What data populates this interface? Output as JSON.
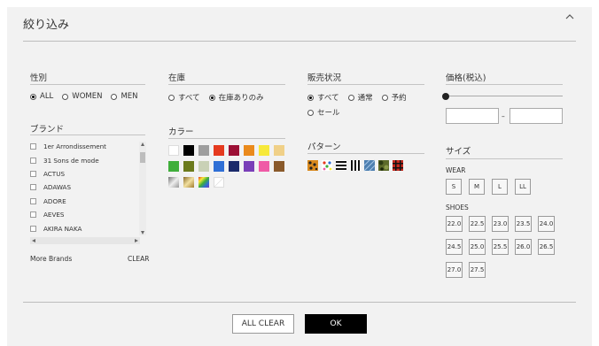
{
  "header": {
    "title": "絞り込み"
  },
  "gender": {
    "title": "性別",
    "options": [
      {
        "label": "ALL",
        "checked": true
      },
      {
        "label": "WOMEN",
        "checked": false
      },
      {
        "label": "MEN",
        "checked": false
      }
    ]
  },
  "stock": {
    "title": "在庫",
    "options": [
      {
        "label": "すべて",
        "checked": false
      },
      {
        "label": "在庫ありのみ",
        "checked": true
      }
    ]
  },
  "sales": {
    "title": "販売状況",
    "options": [
      {
        "label": "すべて",
        "checked": true
      },
      {
        "label": "通常",
        "checked": false
      },
      {
        "label": "予約",
        "checked": false
      },
      {
        "label": "セール",
        "checked": false
      }
    ]
  },
  "price": {
    "title": "価格(税込)",
    "separator": "–"
  },
  "brand": {
    "title": "ブランド",
    "items": [
      "1er Arrondissement",
      "31 Sons de mode",
      "ACTUS",
      "ADAWAS",
      "ADORE",
      "AEVES",
      "AKIRA NAKA"
    ],
    "more": "More Brands",
    "clear": "CLEAR"
  },
  "color": {
    "title": "カラー",
    "swatches": [
      "#ffffff",
      "#000000",
      "#9e9e9e",
      "#e53a1e",
      "#9c1035",
      "#ea8a1c",
      "#f7e93a",
      "#f0d088",
      "#3fae3a",
      "#6b7a1c",
      "#c9d1b6",
      "#2f6fd6",
      "#1c2b6b",
      "#7a3fb8",
      "#ef5aa6",
      "#8a5a2b",
      "#b7b7b7",
      "#c9b36a",
      "#3ab0ff",
      "#ffffff"
    ]
  },
  "pattern": {
    "title": "パターン",
    "items": [
      "leopard",
      "dot",
      "border",
      "stripe",
      "denim",
      "camo",
      "check"
    ]
  },
  "size": {
    "title": "サイズ",
    "wear_label": "WEAR",
    "wear": [
      "S",
      "M",
      "L",
      "LL"
    ],
    "shoes_label": "SHOES",
    "shoes": [
      "22.0",
      "22.5",
      "23.0",
      "23.5",
      "24.0",
      "24.5",
      "25.0",
      "25.5",
      "26.0",
      "26.5",
      "27.0",
      "27.5"
    ]
  },
  "buttons": {
    "all_clear": "ALL CLEAR",
    "ok": "OK"
  }
}
